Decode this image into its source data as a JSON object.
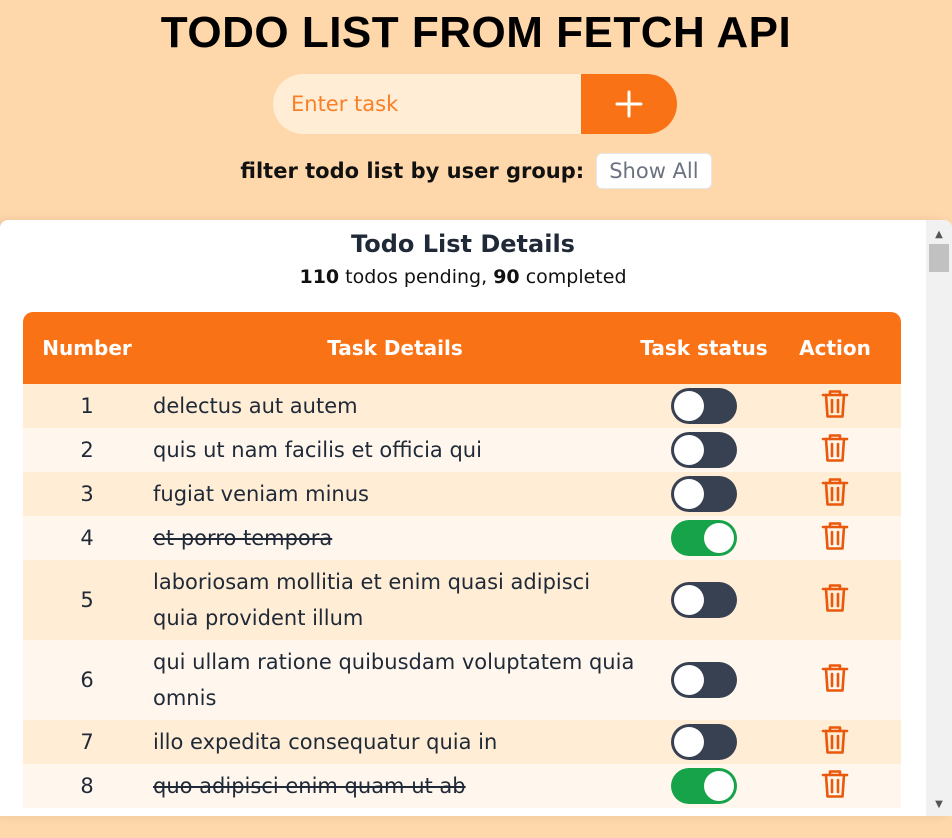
{
  "header": {
    "title": "TODO LIST FROM FETCH API"
  },
  "form": {
    "placeholder": "Enter task",
    "add_icon": "plus-icon"
  },
  "filter": {
    "label": "filter todo list by user group:",
    "selected": "Show All"
  },
  "panel": {
    "title": "Todo List Details",
    "pending_count": "110",
    "pending_text": " todos pending, ",
    "completed_count": "90",
    "completed_text": " completed"
  },
  "table": {
    "headers": [
      "Number",
      "Task Details",
      "Task status",
      "Action"
    ],
    "rows": [
      {
        "number": "1",
        "task": "delectus aut autem",
        "completed": false
      },
      {
        "number": "2",
        "task": "quis ut nam facilis et officia qui",
        "completed": false
      },
      {
        "number": "3",
        "task": "fugiat veniam minus",
        "completed": false
      },
      {
        "number": "4",
        "task": "et porro tempora",
        "completed": true
      },
      {
        "number": "5",
        "task": "laboriosam mollitia et enim quasi adipisci quia provident illum",
        "completed": false
      },
      {
        "number": "6",
        "task": "qui ullam ratione quibusdam voluptatem quia omnis",
        "completed": false
      },
      {
        "number": "7",
        "task": "illo expedita consequatur quia in",
        "completed": false
      },
      {
        "number": "8",
        "task": "quo adipisci enim quam ut ab",
        "completed": true
      }
    ]
  },
  "colors": {
    "background": "#fed7aa",
    "accent": "#f97316",
    "toggle_off": "#374151",
    "toggle_on": "#16a34a",
    "trash_icon": "#ea580c"
  }
}
